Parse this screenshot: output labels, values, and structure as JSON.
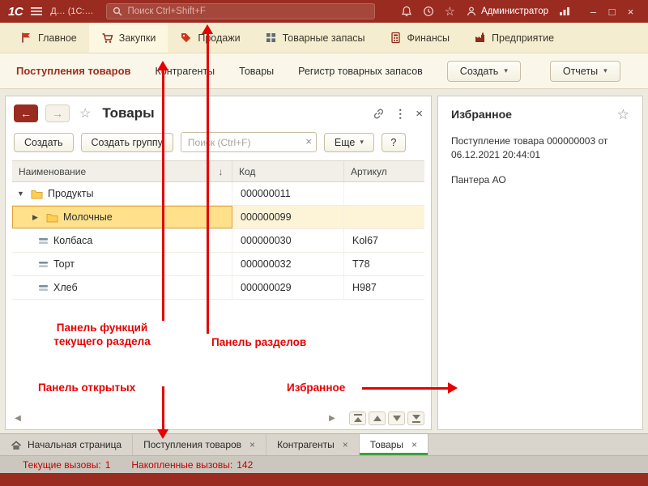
{
  "ui": {
    "caret": "▾",
    "back": "←",
    "forward": "→",
    "star": "☆",
    "dots": "⋮",
    "close": "×",
    "minimize": "–",
    "maximize": "□",
    "left_arrow": "◀",
    "right_arrow": "▶",
    "expand_open": "▼",
    "expand_closed": "▶"
  },
  "titlebar": {
    "logo": "1С",
    "app_title": "Д…  (1С:…",
    "search_placeholder": "Поиск Ctrl+Shift+F",
    "user_name": "Администратор"
  },
  "sections": {
    "items": [
      {
        "label": "Главное",
        "icon": "flag-icon"
      },
      {
        "label": "Закупки",
        "icon": "cart-icon",
        "active": true
      },
      {
        "label": "Продажи",
        "icon": "sales-tag-icon"
      },
      {
        "label": "Товарные запасы",
        "icon": "stock-grid-icon"
      },
      {
        "label": "Финансы",
        "icon": "calculator-icon"
      },
      {
        "label": "Предприятие",
        "icon": "factory-icon"
      }
    ]
  },
  "functions": {
    "items": [
      "Поступления товаров",
      "Контрагенты",
      "Товары",
      "Регистр товарных запасов"
    ],
    "create_label": "Создать",
    "reports_label": "Отчеты"
  },
  "window": {
    "title": "Товары",
    "create_label": "Создать",
    "create_group_label": "Создать группу",
    "search_placeholder": "Поиск (Ctrl+F)",
    "more_label": "Еще",
    "help_label": "?",
    "table": {
      "headers": {
        "name": "Наименование",
        "sort": "↓",
        "code": "Код",
        "article": "Артикул"
      },
      "rows": [
        {
          "name": "Продукты",
          "code": "000000011",
          "article": ""
        },
        {
          "name": "Молочные",
          "code": "000000099",
          "article": ""
        },
        {
          "name": "Колбаса",
          "code": "000000030",
          "article": "Kol67"
        },
        {
          "name": "Торт",
          "code": "000000032",
          "article": "T78"
        },
        {
          "name": "Хлеб",
          "code": "000000029",
          "article": "H987"
        }
      ]
    }
  },
  "favorites": {
    "title": "Избранное",
    "entries": [
      "Поступление товара 000000003 от 06.12.2021 20:44:01",
      "Пантера АО"
    ]
  },
  "annotations": {
    "functions_line1": "Панель функций",
    "functions_line2": "текущего раздела",
    "sections": "Панель разделов",
    "open_tabs": "Панель открытых",
    "favorites": "Избранное"
  },
  "taskbar": {
    "tabs": [
      {
        "label": "Начальная страница"
      },
      {
        "label": "Поступления товаров",
        "closable": true
      },
      {
        "label": "Контрагенты",
        "closable": true
      },
      {
        "label": "Товары",
        "closable": true,
        "active": true
      }
    ]
  },
  "statusbar": {
    "current_label": "Текущие вызовы:",
    "current_value": "1",
    "accumulated_label": "Накопленные вызовы:",
    "accumulated_value": "142"
  },
  "colors": {
    "frame": "#9A2B21",
    "section_bar": "#F5EDCF",
    "selection": "#FFE18C",
    "annotation": "#E60000",
    "active_tab_underline": "#3FA03A"
  }
}
